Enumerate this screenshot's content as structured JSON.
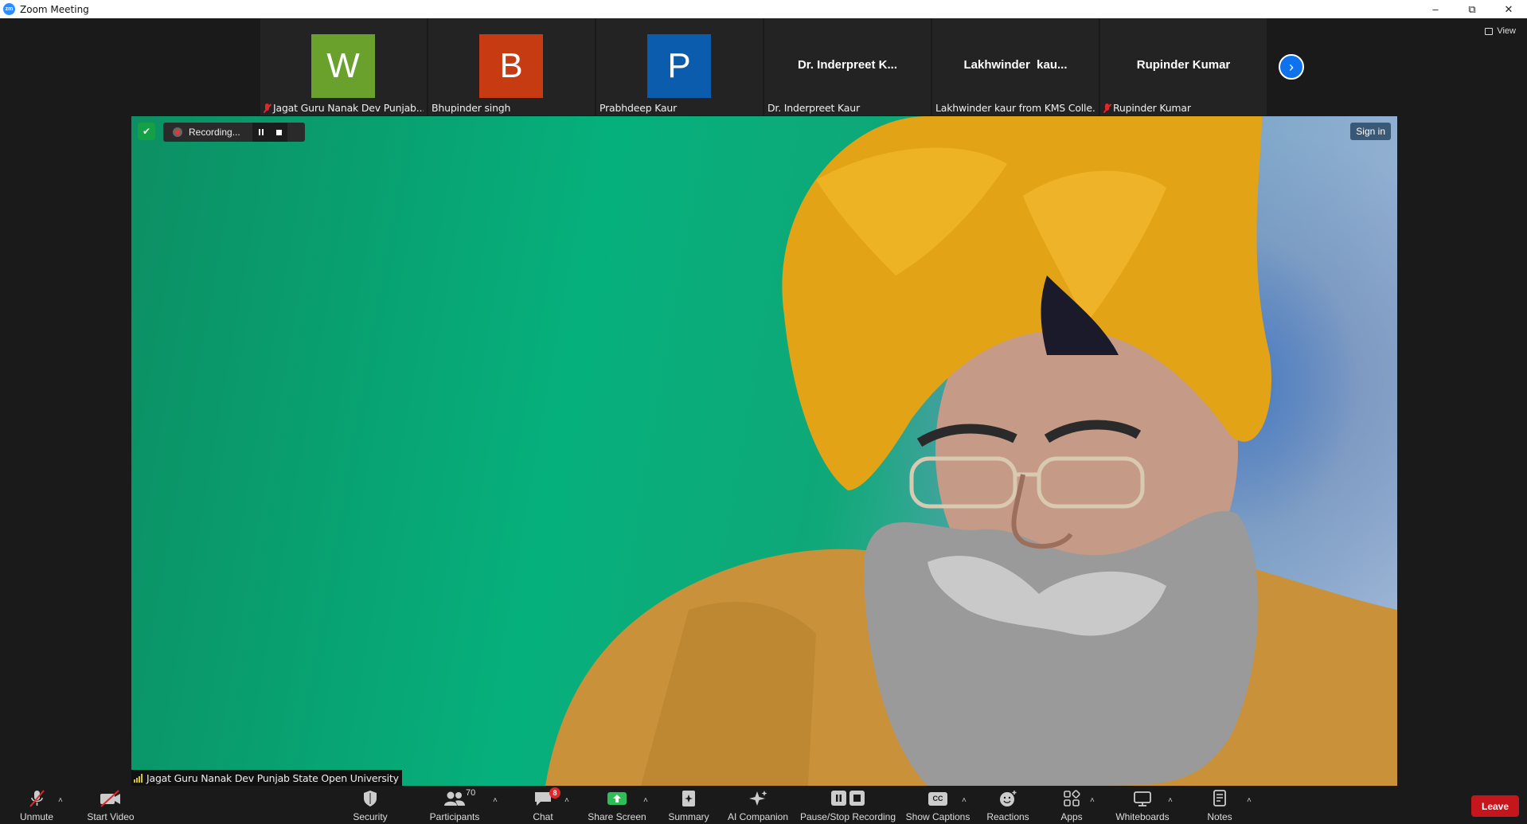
{
  "window": {
    "title": "Zoom Meeting",
    "app_icon_text": "zm",
    "controls": [
      "minimize-icon",
      "restore-icon",
      "close-icon"
    ]
  },
  "view_button": {
    "label": "View"
  },
  "participants_strip": [
    {
      "initial": "W",
      "color": "#6aa02c",
      "label": "Jagat Guru Nanak Dev Punjab...",
      "muted": true
    },
    {
      "initial": "B",
      "color": "#c63b12",
      "label": "Bhupinder singh",
      "muted": false
    },
    {
      "initial": "P",
      "color": "#0b5cad",
      "label": "Prabhdeep Kaur",
      "muted": false
    },
    {
      "display_name": "Dr. Inderpreet K...",
      "label": "Dr. Inderpreet Kaur",
      "muted": false
    },
    {
      "display_name": "Lakhwinder  kau...",
      "label": "Lakhwinder kaur from KMS Colle...",
      "muted": false
    },
    {
      "display_name": "Rupinder Kumar",
      "label": "Rupinder Kumar",
      "muted": true
    }
  ],
  "recording": {
    "text": "Recording..."
  },
  "sign_in": {
    "label": "Sign in"
  },
  "active_speaker": {
    "name": "Jagat Guru Nanak Dev Punjab State Open University"
  },
  "toolbar": {
    "unmute": "Unmute",
    "start_video": "Start Video",
    "security": "Security",
    "participants": "Participants",
    "participants_count": "70",
    "chat": "Chat",
    "chat_badge": "8",
    "share_screen": "Share Screen",
    "summary": "Summary",
    "ai_companion": "AI Companion",
    "pause_stop_recording": "Pause/Stop Recording",
    "show_captions": "Show Captions",
    "captions_icon_text": "CC",
    "reactions": "Reactions",
    "apps": "Apps",
    "whiteboards": "Whiteboards",
    "notes": "Notes",
    "leave": "Leave"
  },
  "colors": {
    "accent": "#0e72ed",
    "leave": "#c4161c",
    "share_green": "#2fbd5a",
    "secure_green": "#13a046"
  }
}
